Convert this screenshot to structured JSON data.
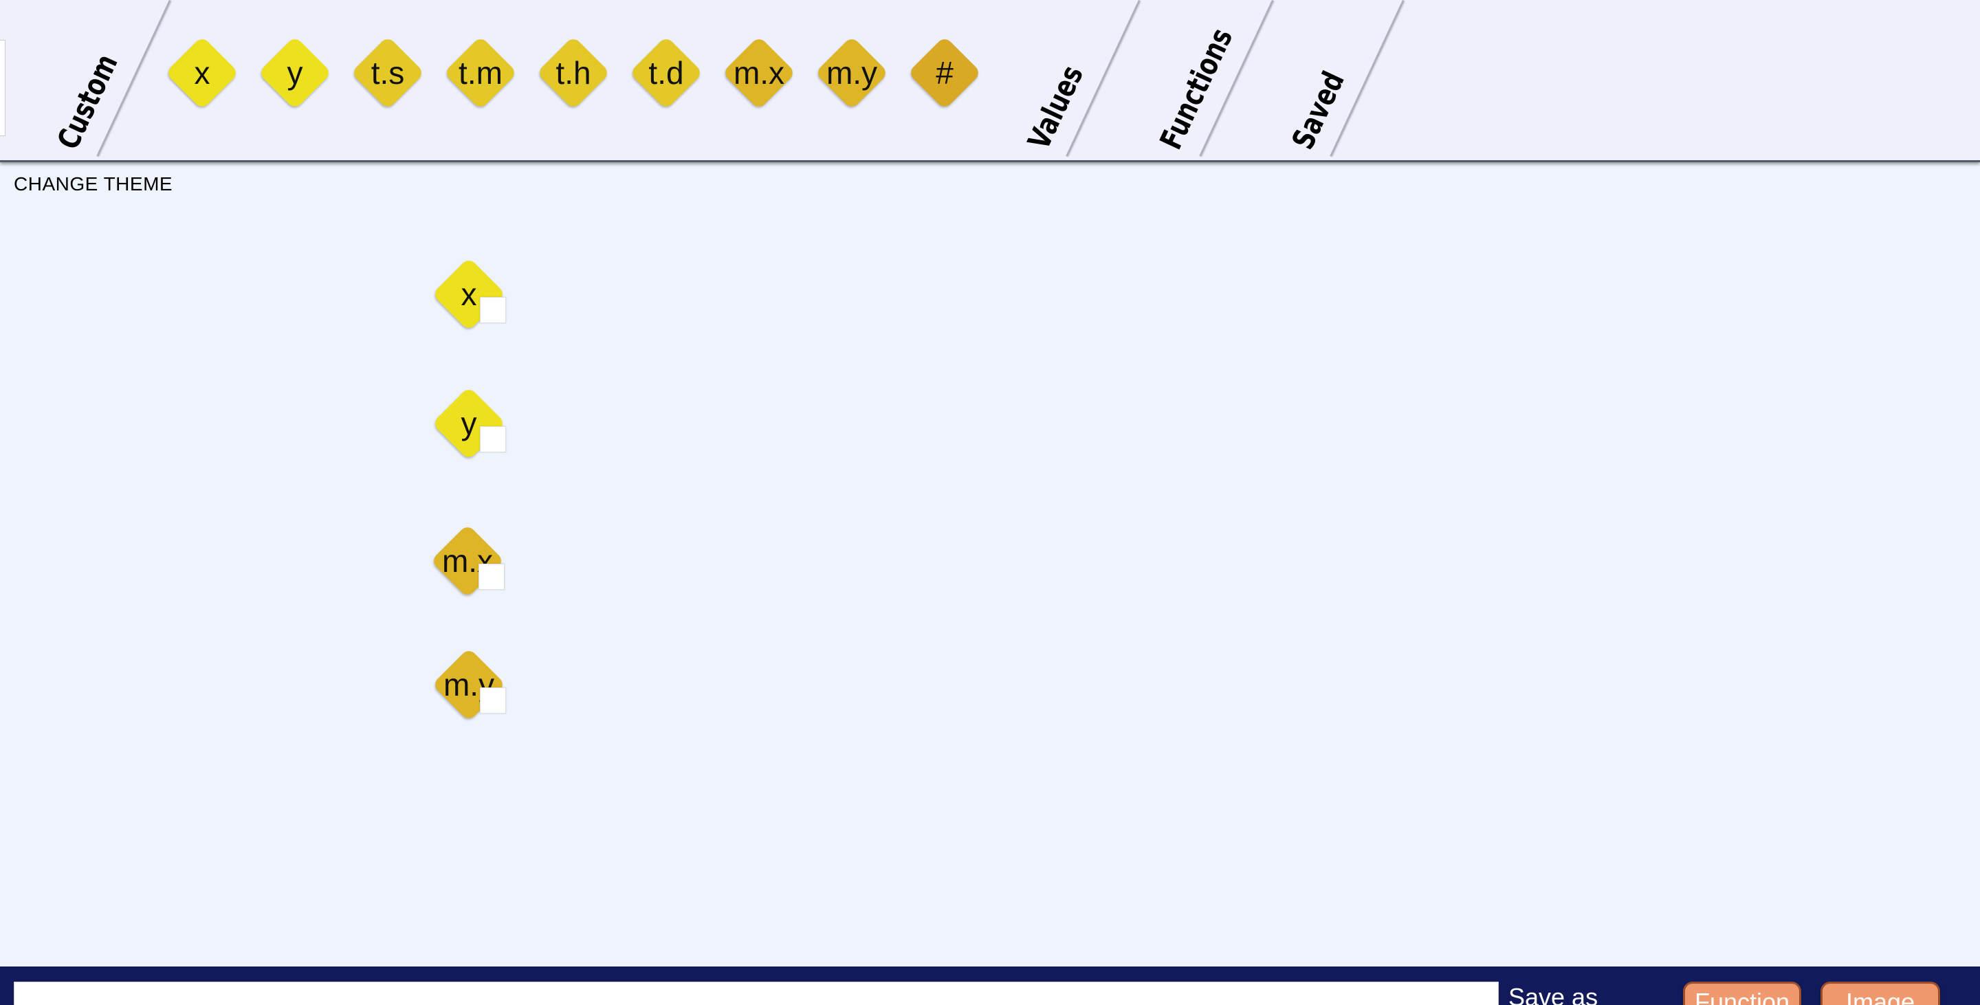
{
  "tabs": {
    "custom": "Custom",
    "values": "Values",
    "functions": "Functions",
    "saved": "Saved"
  },
  "palette": [
    {
      "id": "x",
      "label": "x",
      "color": "#ede11f"
    },
    {
      "id": "y",
      "label": "y",
      "color": "#ede11f"
    },
    {
      "id": "ts",
      "label": "t.s",
      "color": "#e4c828"
    },
    {
      "id": "tm",
      "label": "t.m",
      "color": "#e4c828"
    },
    {
      "id": "th",
      "label": "t.h",
      "color": "#e4c828"
    },
    {
      "id": "td",
      "label": "t.d",
      "color": "#e4c828"
    },
    {
      "id": "mx",
      "label": "m.x",
      "color": "#deb526"
    },
    {
      "id": "my",
      "label": "m.y",
      "color": "#deb526"
    },
    {
      "id": "num",
      "label": "#",
      "color": "#d9a824"
    }
  ],
  "theme_link": "CHANGE THEME",
  "workspace": [
    {
      "id": "x",
      "label": "x",
      "color": "#ede11f"
    },
    {
      "id": "y",
      "label": "y",
      "color": "#ede11f"
    },
    {
      "id": "mx",
      "label": "m.x",
      "color": "#deb526"
    },
    {
      "id": "my",
      "label": "m.y",
      "color": "#deb526"
    }
  ],
  "bottom": {
    "name_value": "",
    "save_as_label": "Save as",
    "function_button": "Function",
    "image_button": "Image"
  }
}
